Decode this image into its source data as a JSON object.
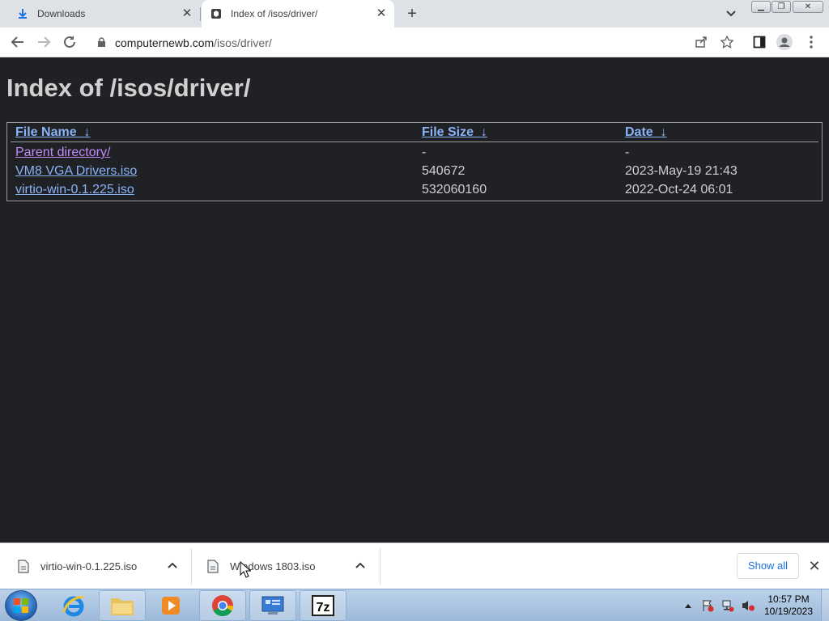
{
  "browser": {
    "tabs": [
      {
        "title": "Downloads",
        "icon": "download-icon",
        "active": false
      },
      {
        "title": "Index of /isos/driver/",
        "icon": "site-favicon",
        "active": true
      }
    ],
    "address": {
      "host": "computernewb.com",
      "path": "/isos/driver/"
    }
  },
  "page": {
    "title": "Index of /isos/driver/",
    "columns": {
      "name": "File Name",
      "size": "File Size",
      "date": "Date",
      "sort_glyph": "↓"
    },
    "rows": [
      {
        "name": "Parent directory/",
        "size": "-",
        "date": "-"
      },
      {
        "name": "VM8 VGA Drivers.iso",
        "size": "540672",
        "date": "2023-May-19 21:43"
      },
      {
        "name": "virtio-win-0.1.225.iso",
        "size": "532060160",
        "date": "2022-Oct-24 06:01"
      }
    ]
  },
  "downloads": {
    "items": [
      {
        "filename": "virtio-win-0.1.225.iso"
      },
      {
        "filename": "Windows 1803.iso"
      }
    ],
    "show_all_label": "Show all"
  },
  "taskbar": {
    "apps": [
      "internet-explorer-icon",
      "file-explorer-icon",
      "media-player-icon",
      "chrome-icon",
      "control-panel-icon",
      "7zip-icon"
    ],
    "clock": {
      "time": "10:57 PM",
      "date": "10/19/2023"
    }
  },
  "colors": {
    "page_bg": "#202124",
    "link": "#8ab4f8",
    "visited": "#c58af9",
    "accent": "#1a73e8"
  }
}
